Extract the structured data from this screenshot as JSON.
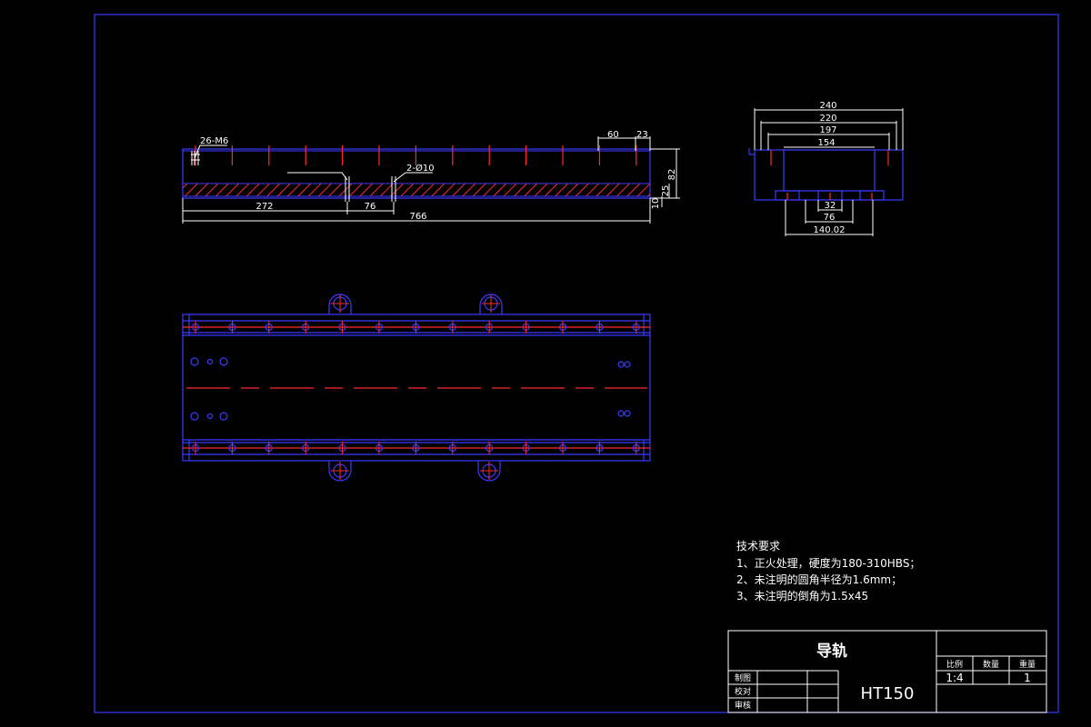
{
  "colors": {
    "background": "#000000",
    "outline": "#3a3aff",
    "center_line": "#ff2a2a",
    "dimension": "#ffffff",
    "text": "#ffffff"
  },
  "front_view": {
    "thread_callout": "26-M6",
    "hole_callout": "2-Ø10",
    "dims": {
      "d60": "60",
      "d23": "23",
      "d82": "82",
      "d25": "25",
      "d10": "10",
      "d272": "272",
      "d76": "76",
      "d766": "766"
    }
  },
  "side_view": {
    "dims": {
      "d240": "240",
      "d220": "220",
      "d197": "197",
      "d154": "154",
      "d32": "32",
      "d76": "76",
      "d140": "140.02"
    }
  },
  "tech_requirements": {
    "title": "技术要求",
    "items": [
      "1、正火处理，硬度为180-310HBS；",
      "2、未注明的圆角半径为1.6mm；",
      "3、未注明的倒角为1.5x45"
    ]
  },
  "title_block": {
    "part_name": "导轨",
    "material": "HT150",
    "headers": {
      "scale": "比例",
      "count": "数量",
      "weight": "重量"
    },
    "values": {
      "scale": "1:4",
      "count": "",
      "weight": "1"
    },
    "rows": {
      "drawn": "制图",
      "checked": "校对",
      "approved": "审核"
    }
  }
}
